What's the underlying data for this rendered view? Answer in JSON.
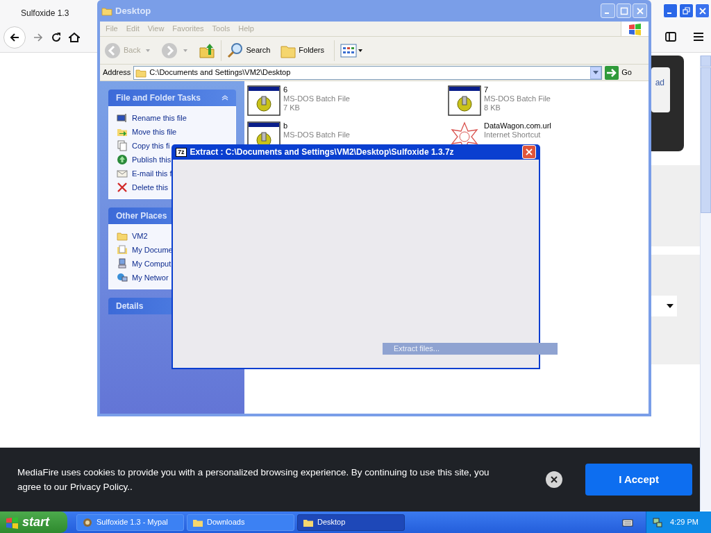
{
  "browser": {
    "tab_title": "Sulfoxide 1.3",
    "page_card_text": "ad"
  },
  "explorer": {
    "title": "Desktop",
    "menu": [
      {
        "label": "File",
        "disabled": true
      },
      {
        "label": "Edit",
        "disabled": true
      },
      {
        "label": "View",
        "disabled": true
      },
      {
        "label": "Favorites",
        "disabled": true
      },
      {
        "label": "Tools",
        "disabled": true
      },
      {
        "label": "Help",
        "disabled": true
      }
    ],
    "toolbar": {
      "back": {
        "label": "Back",
        "disabled": true
      },
      "search": "Search",
      "folders": "Folders"
    },
    "address": {
      "label": "Address",
      "value": "C:\\Documents and Settings\\VM2\\Desktop",
      "go": "Go"
    },
    "panels": [
      {
        "title": "File and Folder Tasks",
        "has_toggle": true,
        "items": [
          {
            "label": "Rename this file",
            "kind": "rename"
          },
          {
            "label": "Move this file",
            "kind": "move"
          },
          {
            "label": "Copy this fi",
            "kind": "copy"
          },
          {
            "label": "Publish this",
            "kind": "publish"
          },
          {
            "label": "E-mail this f",
            "kind": "email"
          },
          {
            "label": "Delete this",
            "kind": "delete"
          }
        ]
      },
      {
        "title": "Other Places",
        "items": [
          {
            "label": "VM2",
            "kind": "folder"
          },
          {
            "label": "My Docume",
            "kind": "documents"
          },
          {
            "label": "My Comput",
            "kind": "computer"
          },
          {
            "label": "My Networ",
            "kind": "network"
          }
        ]
      },
      {
        "title": "Details"
      }
    ],
    "files": [
      {
        "name": "6",
        "type": "MS-DOS Batch File",
        "size": "7 KB",
        "kind": "batch"
      },
      {
        "name": "7",
        "type": "MS-DOS Batch File",
        "size": "8 KB",
        "kind": "batch"
      },
      {
        "name": "b",
        "type": "MS-DOS Batch File",
        "kind": "batch"
      },
      {
        "name": "DataWagon.com.url",
        "type": "Internet Shortcut",
        "kind": "shortcut"
      }
    ]
  },
  "dialog": {
    "icon_text": "7z",
    "title": "Extract : C:\\Documents and Settings\\VM2\\Desktop\\Sulfoxide 1.3.7z",
    "status": "Extract files..."
  },
  "cookie_banner": {
    "message": "MediaFire uses cookies to provide you with a personalized browsing experience. By continuing to use this site, you agree to our Privacy Policy..",
    "accept": "I Accept"
  },
  "taskbar": {
    "start": "start",
    "tasks": [
      {
        "label": "Sulfoxide 1.3 - Mypal",
        "kind": "browser",
        "selected": false
      },
      {
        "label": "Downloads",
        "kind": "folder",
        "selected": false
      },
      {
        "label": "Desktop",
        "kind": "folder",
        "selected": true
      }
    ],
    "clock": "4:29 PM"
  }
}
